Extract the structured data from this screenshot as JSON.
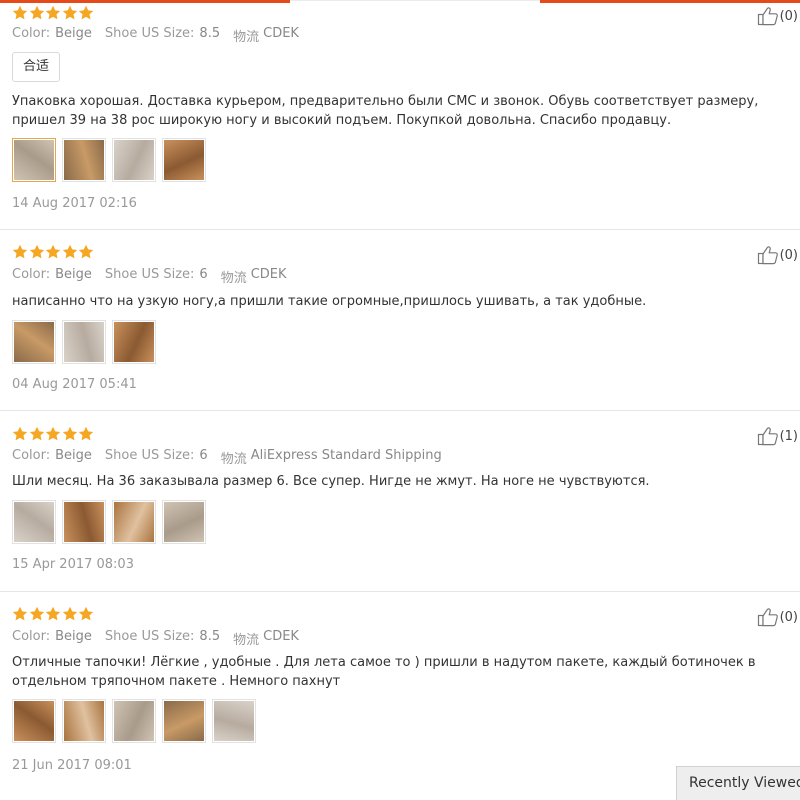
{
  "labels": {
    "color": "Color:",
    "size": "Shoe US Size:",
    "shipping": "物流"
  },
  "reviews": [
    {
      "rating": 5,
      "color": "Beige",
      "size": "8.5",
      "shipping": "CDEK",
      "helpful": "(0)",
      "tag": "合适",
      "text": "Упаковка хорошая. Доставка курьером, предварительно были СМС и звонок. Обувь соответствует размеру, пришел 39 на 38 рос широкую ногу и высокий подъем. Покупкой довольна. Спасибо продавцу.",
      "photo_count": 4,
      "date": "14 Aug 2017 02:16"
    },
    {
      "rating": 5,
      "color": "Beige",
      "size": "6",
      "shipping": "CDEK",
      "helpful": "(0)",
      "text": "написанно что на узкую ногу,а пришли такие огромные,пришлось ушивать, а так удобные.",
      "photo_count": 3,
      "date": "04 Aug 2017 05:41"
    },
    {
      "rating": 5,
      "color": "Beige",
      "size": "6",
      "shipping": "AliExpress Standard Shipping",
      "helpful": "(1)",
      "text": "Шли месяц. На 36 заказывала размер 6. Все супер. Нигде не жмут. На ноге не чувствуются.",
      "photo_count": 4,
      "date": "15 Apr 2017 08:03"
    },
    {
      "rating": 5,
      "color": "Beige",
      "size": "8.5",
      "shipping": "CDEK",
      "helpful": "(0)",
      "text": "Отличные тапочки! Лёгкие , удобные . Для лета самое то ) пришли в надутом пакете, каждый ботиночек в отдельном тряпочном пакете . Немного пахнут",
      "photo_count": 5,
      "date": "21 Jun 2017 09:01"
    }
  ],
  "recently_viewed": "Recently Viewed",
  "colors": {
    "star": "#f5a623",
    "accent": "#e64a19",
    "muted": "#999999"
  }
}
